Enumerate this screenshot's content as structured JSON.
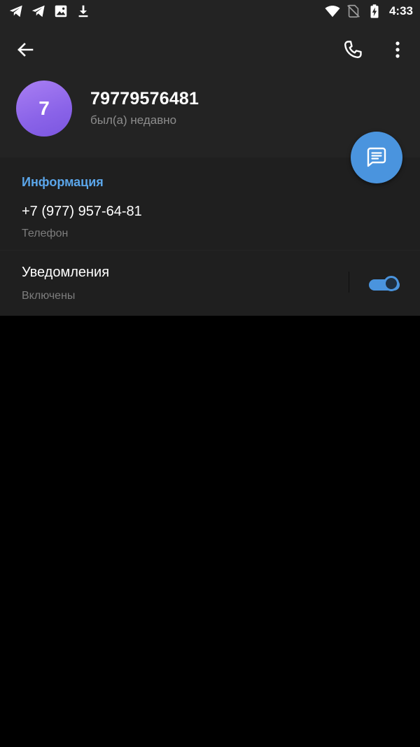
{
  "status_bar": {
    "time": "4:33",
    "icons_left": [
      "telegram-icon",
      "telegram-icon",
      "image-icon",
      "download-icon"
    ],
    "icons_right": [
      "wifi-icon",
      "no-sim-icon",
      "battery-charging-icon"
    ]
  },
  "header": {
    "avatar_letter": "7",
    "name": "79779576481",
    "status": "был(а) недавно",
    "avatar_gradient": [
      "#a97ff3",
      "#7b56e0"
    ]
  },
  "info": {
    "section_title": "Информация",
    "phone_value": "+7 (977) 957-64-81",
    "phone_label": "Телефон"
  },
  "notifications": {
    "title": "Уведомления",
    "value": "Включены",
    "enabled": true
  },
  "colors": {
    "accent": "#4a94de",
    "section_title": "#5ba6ea",
    "header_bg": "#232323",
    "content_bg": "#1f1f1f",
    "page_bg": "#000000"
  }
}
